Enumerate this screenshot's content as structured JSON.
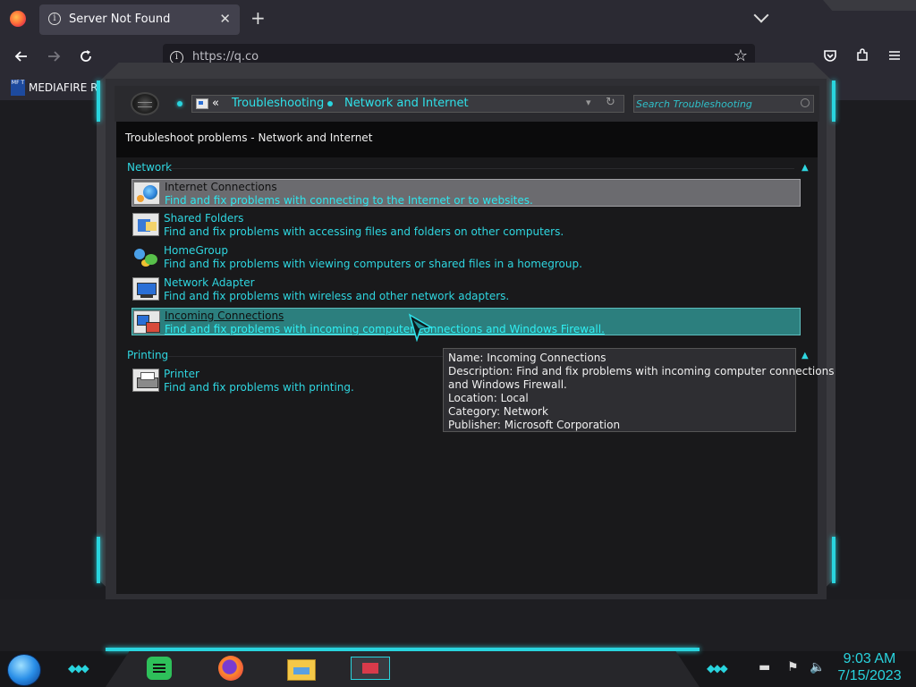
{
  "browser": {
    "tab_title": "Server Not Found",
    "tab_close": "✕",
    "new_tab": "+",
    "url_display": "https://q.co",
    "bookmark_label": "MEDIAFIRE RO",
    "bookmark_icon_text": "MF T"
  },
  "window": {
    "breadcrumb": {
      "overflow": "«",
      "items": [
        "Troubleshooting",
        "Network and Internet"
      ]
    },
    "search_placeholder": "Search Troubleshooting",
    "header_title": "Troubleshoot problems - Network and Internet",
    "groups": [
      {
        "title": "Network",
        "items": [
          {
            "name": "Internet Connections",
            "desc": "Find and fix problems with connecting to the Internet or to websites.",
            "icon": "internet-connections-icon",
            "state": "hover"
          },
          {
            "name": "Shared Folders",
            "desc": "Find and fix problems with accessing files and folders on other computers.",
            "icon": "shared-folders-icon",
            "state": "normal"
          },
          {
            "name": "HomeGroup",
            "desc": "Find and fix problems with viewing computers or shared files in a homegroup.",
            "icon": "homegroup-icon",
            "state": "normal"
          },
          {
            "name": "Network Adapter",
            "desc": "Find and fix problems with wireless and other network adapters.",
            "icon": "network-adapter-icon",
            "state": "normal"
          },
          {
            "name": "Incoming Connections",
            "desc": "Find and fix problems with incoming computer connections and Windows Firewall.",
            "icon": "incoming-connections-icon",
            "state": "selected"
          }
        ]
      },
      {
        "title": "Printing",
        "items": [
          {
            "name": "Printer",
            "desc": "Find and fix problems with printing.",
            "icon": "printer-icon",
            "state": "normal"
          }
        ]
      }
    ],
    "tooltip": {
      "line1": "Name: Incoming Connections",
      "line2": "Description: Find and fix problems with incoming computer connections",
      "line3": "and Windows Firewall.",
      "line4": "Location: Local",
      "line5": "Category: Network",
      "line6": "Publisher: Microsoft Corporation"
    }
  },
  "taskbar": {
    "time": "9:03 AM",
    "date": "7/15/2023",
    "apps": [
      "notes-app-icon",
      "firefox-icon",
      "file-explorer-icon",
      "control-panel-icon"
    ]
  },
  "colors": {
    "accent": "#29d4de",
    "link": "#2fd6e0",
    "selected_bg": "#2c7f7e",
    "hover_bg": "#6b6b6f"
  }
}
